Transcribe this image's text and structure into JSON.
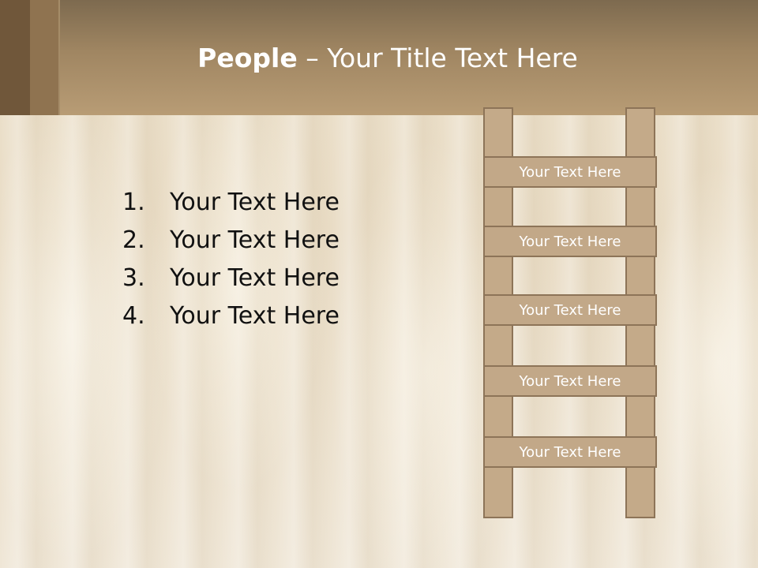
{
  "slide": {
    "title_bold": "People",
    "title_rest": " – Your Title Text Here",
    "list": [
      {
        "number": "1.",
        "text": "Your Text Here"
      },
      {
        "number": "2.",
        "text": "Your Text Here"
      },
      {
        "number": "3.",
        "text": "Your Text Here"
      },
      {
        "number": "4.",
        "text": "Your Text Here"
      }
    ],
    "ladder_rungs": [
      "Your Text Here",
      "Your Text Here",
      "Your Text Here",
      "Your Text Here",
      "Your Text Here"
    ]
  },
  "colors": {
    "title_bar": "#a08662",
    "ladder_fill": "#c2a888",
    "ladder_border": "#8d7458",
    "title_text": "#ffffff"
  }
}
